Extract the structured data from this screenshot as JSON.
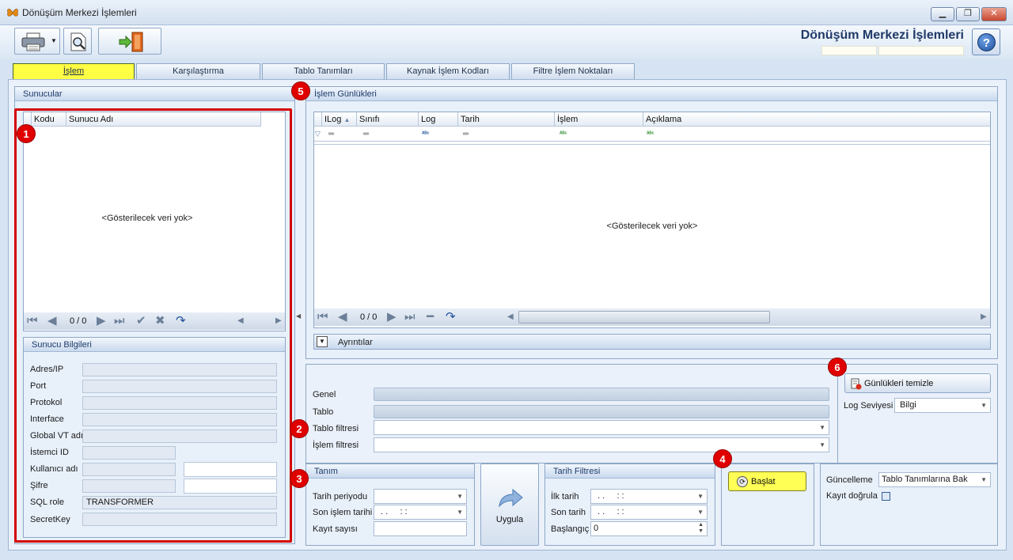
{
  "window": {
    "title": "Dönüşüm Merkezi İşlemleri",
    "heading": "Dönüşüm Merkezi İşlemleri"
  },
  "tabs": [
    {
      "label": "İşlem"
    },
    {
      "label": "Karşılaştırma"
    },
    {
      "label": "Tablo Tanımları"
    },
    {
      "label": "Kaynak İşlem Kodları"
    },
    {
      "label": "Filtre İşlem Noktaları"
    }
  ],
  "sunucular": {
    "title": "Sunucular",
    "columns": [
      "Kodu",
      "Sunucu Adı"
    ],
    "empty": "<Gösterilecek veri yok>",
    "nav_count": "0 / 0"
  },
  "sunucu_bilgileri": {
    "title": "Sunucu Bilgileri",
    "fields": [
      {
        "label": "Adres/IP",
        "value": ""
      },
      {
        "label": "Port",
        "value": ""
      },
      {
        "label": "Protokol",
        "value": ""
      },
      {
        "label": "Interface",
        "value": ""
      },
      {
        "label": "Global VT adı",
        "value": ""
      },
      {
        "label": "İstemci ID",
        "value": ""
      },
      {
        "label": "Kullanıcı adı",
        "value": ""
      },
      {
        "label": "Şifre",
        "value": ""
      },
      {
        "label": "SQL role",
        "value": "TRANSFORMER"
      },
      {
        "label": "SecretKey",
        "value": ""
      }
    ]
  },
  "islem_gunlukleri": {
    "title": "İşlem Günlükleri",
    "columns": [
      "ILog",
      "Sınıfı",
      "Log Kodu",
      "Tarih",
      "İşlem",
      "Açıklama"
    ],
    "empty": "<Gösterilecek veri yok>",
    "nav_count": "0 / 0",
    "details_label": "Ayrıntılar"
  },
  "filters": {
    "genel_label": "Genel",
    "tablo_label": "Tablo",
    "tablo_filtresi_label": "Tablo filtresi",
    "islem_filtresi_label": "İşlem filtresi"
  },
  "gunlukleri_temizle": "Günlükleri temizle",
  "log_seviyesi": {
    "label": "Log Seviyesi",
    "value": "Bilgi"
  },
  "tanim": {
    "title": "Tanım",
    "tarih_periyodu": "Tarih periyodu",
    "son_islem_tarihi": "Son işlem tarihi",
    "son_islem_value": ". .     : :",
    "kayit_sayisi": "Kayıt sayısı"
  },
  "uygula": "Uygula",
  "tarih_filtresi": {
    "title": "Tarih Filtresi",
    "ilk_tarih": "İlk tarih",
    "ilk_value": ". .     : :",
    "son_tarih": "Son tarih",
    "son_value": ". .     : :",
    "baslangic": "Başlangıç",
    "baslangic_value": "0"
  },
  "baslat": "Başlat",
  "guncelleme": {
    "label": "Güncelleme",
    "value": "Tablo Tanımlarına Bak"
  },
  "kayit_dogrula": "Kayıt doğrula",
  "badges": [
    "1",
    "2",
    "3",
    "4",
    "5",
    "6"
  ],
  "colors": {
    "highlight": "#ffff44",
    "annotation": "#e00000",
    "heading": "#1f3a68"
  }
}
